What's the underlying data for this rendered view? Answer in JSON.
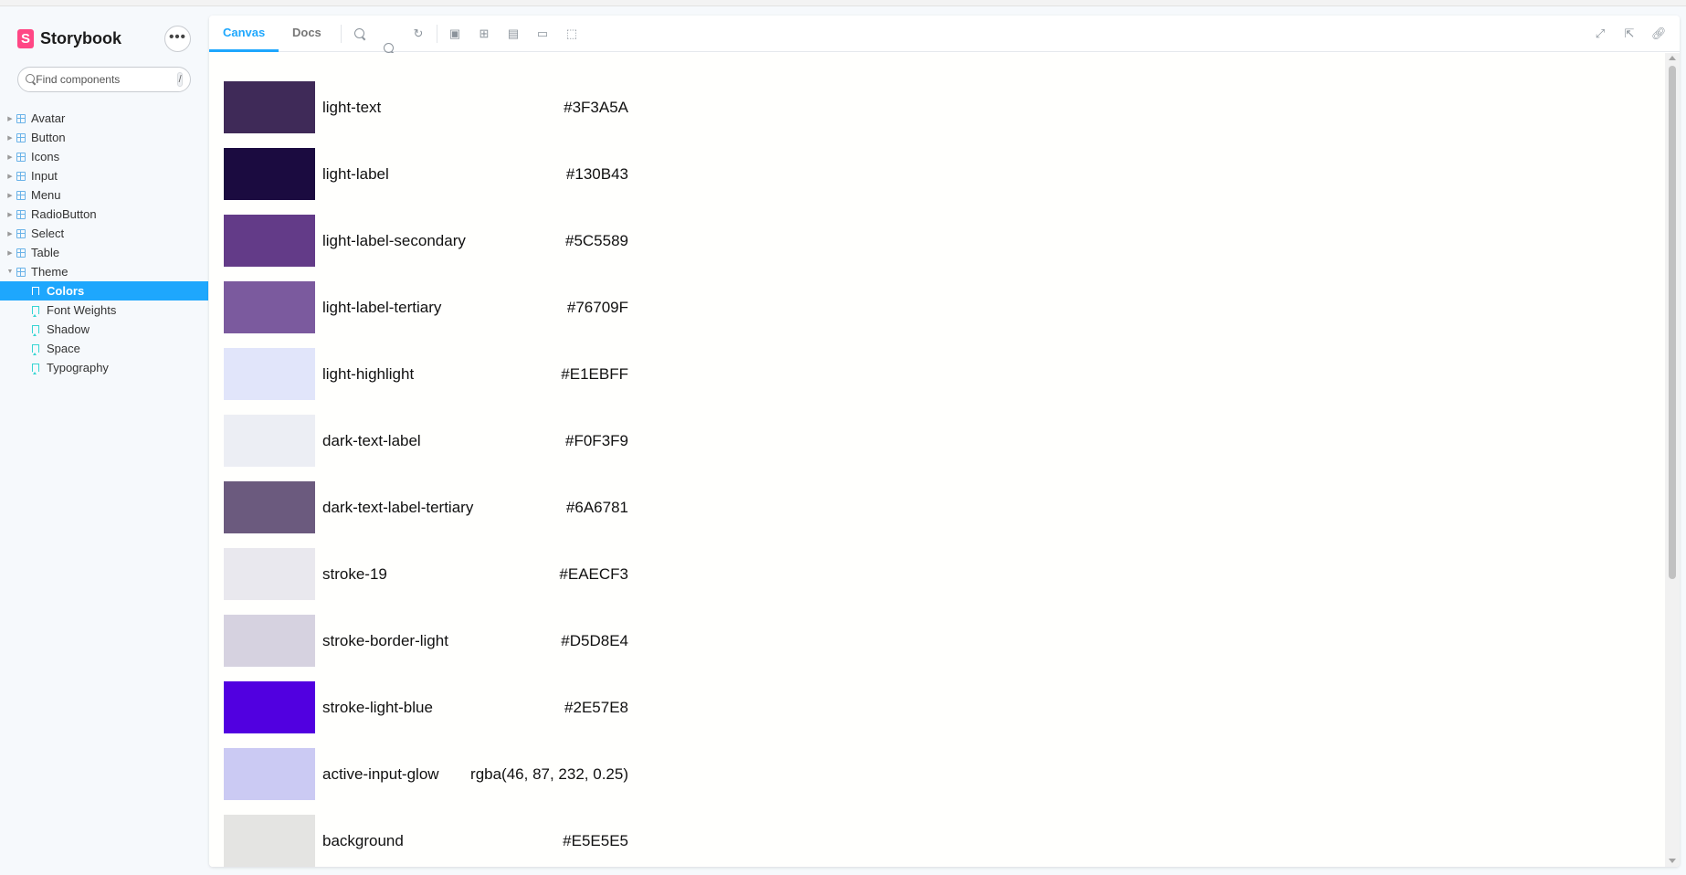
{
  "brand": {
    "name": "Storybook",
    "logo_letter": "S"
  },
  "menu_button": "•••",
  "search": {
    "placeholder": "Find components",
    "shortcut": "/"
  },
  "tree": [
    {
      "label": "Avatar"
    },
    {
      "label": "Button"
    },
    {
      "label": "Icons"
    },
    {
      "label": "Input"
    },
    {
      "label": "Menu"
    },
    {
      "label": "RadioButton"
    },
    {
      "label": "Select"
    },
    {
      "label": "Table"
    },
    {
      "label": "Theme"
    }
  ],
  "stories": [
    {
      "label": "Colors",
      "selected": true
    },
    {
      "label": "Font Weights"
    },
    {
      "label": "Shadow"
    },
    {
      "label": "Space"
    },
    {
      "label": "Typography"
    }
  ],
  "toolbar": {
    "tabs": [
      {
        "label": "Canvas",
        "active": true
      },
      {
        "label": "Docs"
      }
    ],
    "icons": [
      "zoom-in-icon",
      "zoom-out-icon",
      "zoom-reset-icon",
      "background-icon",
      "grid-icon",
      "viewport-icon",
      "measure-icon",
      "outline-icon",
      "fullscreen-icon",
      "open-new-tab-icon",
      "copy-link-icon"
    ]
  },
  "colors": [
    {
      "name": "light-text",
      "value": "#3F3A5A",
      "swatch": "#3F2A58"
    },
    {
      "name": "light-label",
      "value": "#130B43",
      "swatch": "#1B0B40"
    },
    {
      "name": "light-label-secondary",
      "value": "#5C5589",
      "swatch": "#633B88"
    },
    {
      "name": "light-label-tertiary",
      "value": "#76709F",
      "swatch": "#7B5A9E"
    },
    {
      "name": "light-highlight",
      "value": "#E1EBFF",
      "swatch": "#E1E5FA"
    },
    {
      "name": "dark-text-label",
      "value": "#F0F3F9",
      "swatch": "#ECEEF4"
    },
    {
      "name": "dark-text-label-tertiary",
      "value": "#6A6781",
      "swatch": "#6B5A7E"
    },
    {
      "name": "stroke-19",
      "value": "#EAECF3",
      "swatch": "#E9E8EE"
    },
    {
      "name": "stroke-border-light",
      "value": "#D5D8E4",
      "swatch": "#D6D2E0"
    },
    {
      "name": "stroke-light-blue",
      "value": "#2E57E8",
      "swatch": "#5100E0"
    },
    {
      "name": "active-input-glow",
      "value": "rgba(46, 87, 232, 0.25)",
      "swatch": "#CBCAF3"
    },
    {
      "name": "background",
      "value": "#E5E5E5",
      "swatch": "#E4E4E2"
    }
  ]
}
